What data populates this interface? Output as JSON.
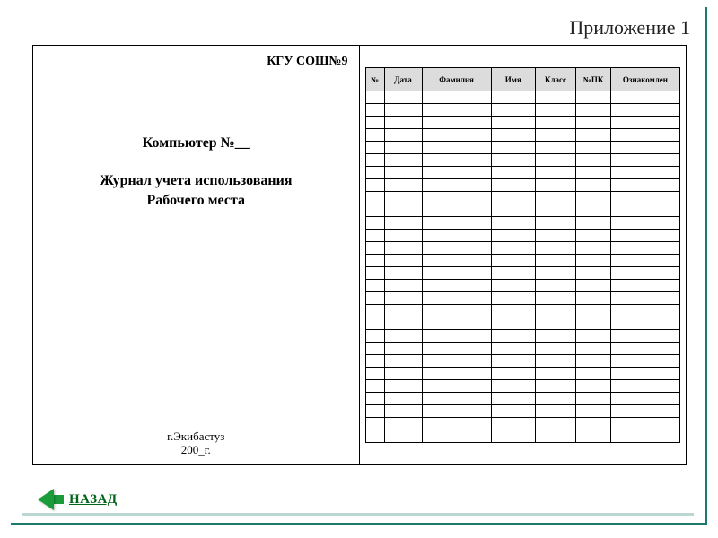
{
  "appendix_label": "Приложение 1",
  "left": {
    "org": "КГУ СОШ№9",
    "computer_line": "Компьютер №__",
    "title_line1": "Журнал учета использования",
    "title_line2": "Рабочего места",
    "city": "г.Экибастуз",
    "year": "200_г."
  },
  "table": {
    "headers": [
      "№",
      "Дата",
      "Фамилия",
      "Имя",
      "Класс",
      "№ПК",
      "Ознакомлен"
    ],
    "row_count": 28
  },
  "back_label": "НАЗАД"
}
